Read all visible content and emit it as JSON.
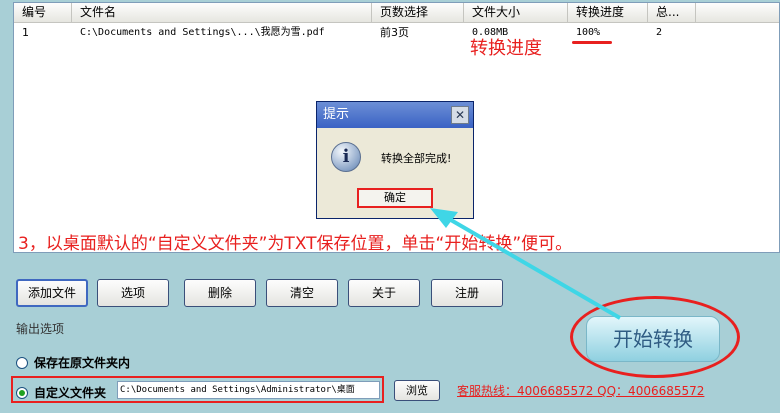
{
  "file_list": {
    "columns": [
      "编号",
      "文件名",
      "页数选择",
      "文件大小",
      "转换进度",
      "总..."
    ],
    "rows": [
      {
        "index": "1",
        "filename": "C:\\Documents and Settings\\...\\我愿为雪.pdf",
        "pages": "前3页",
        "size": "0.08MB",
        "progress": "100%",
        "total": "2"
      }
    ]
  },
  "annotations": {
    "progress_label": "转换进度",
    "instruction": "3，以桌面默认的“自定义文件夹”为TXT保存位置，单击“开始转换”便可。"
  },
  "dialog": {
    "title": "提示",
    "close_glyph": "✕",
    "icon_glyph": "i",
    "message": "转换全部完成!",
    "ok_label": "确定"
  },
  "toolbar": {
    "add_file": "添加文件",
    "options": "选项",
    "delete": "删除",
    "clear": "清空",
    "about": "关于",
    "register": "注册"
  },
  "output": {
    "section_label": "输出选项",
    "save_original": "保存在原文件夹内",
    "custom_folder": "自定义文件夹",
    "path_value": "C:\\Documents and Settings\\Administrator\\桌面",
    "browse": "浏览",
    "selected": "custom_folder"
  },
  "start_button": "开始转换",
  "hotline": "客服热线：4006685572 QQ：4006685572",
  "colors": {
    "annotation_red": "#e8201f",
    "arrow_cyan": "#3fd6e6",
    "background": "#a8cfd6"
  }
}
